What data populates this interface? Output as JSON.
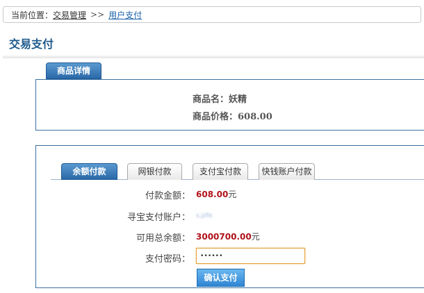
{
  "breadcrumb": {
    "prefix": "当前位置：",
    "items": [
      "交易管理",
      "用户支付"
    ],
    "separator": ">>"
  },
  "page_title": "交易支付",
  "product": {
    "tab_label": "商品详情",
    "name_label": "商品名：",
    "name_value": "妖精",
    "price_label": "商品价格：",
    "price_value": "608.00"
  },
  "payment": {
    "tabs": [
      "余额付款",
      "网银付款",
      "支付宝付款",
      "快钱账户付款"
    ],
    "active_tab": 0,
    "amount_label": "付款金额：",
    "amount_value": "608.00",
    "amount_unit": "元",
    "account_label": "寻宝支付账户：",
    "account_value": "s.jzfe",
    "balance_label": "可用总余额：",
    "balance_value": "3000700.00",
    "balance_unit": "元",
    "password_label": "支付密码：",
    "password_value": "••••••",
    "confirm_label": "确认支付"
  },
  "colors": {
    "accent_blue": "#2a68a8",
    "title_blue": "#1e5a8c",
    "amount_red": "#b0121b",
    "input_focus": "#e3a23a"
  }
}
